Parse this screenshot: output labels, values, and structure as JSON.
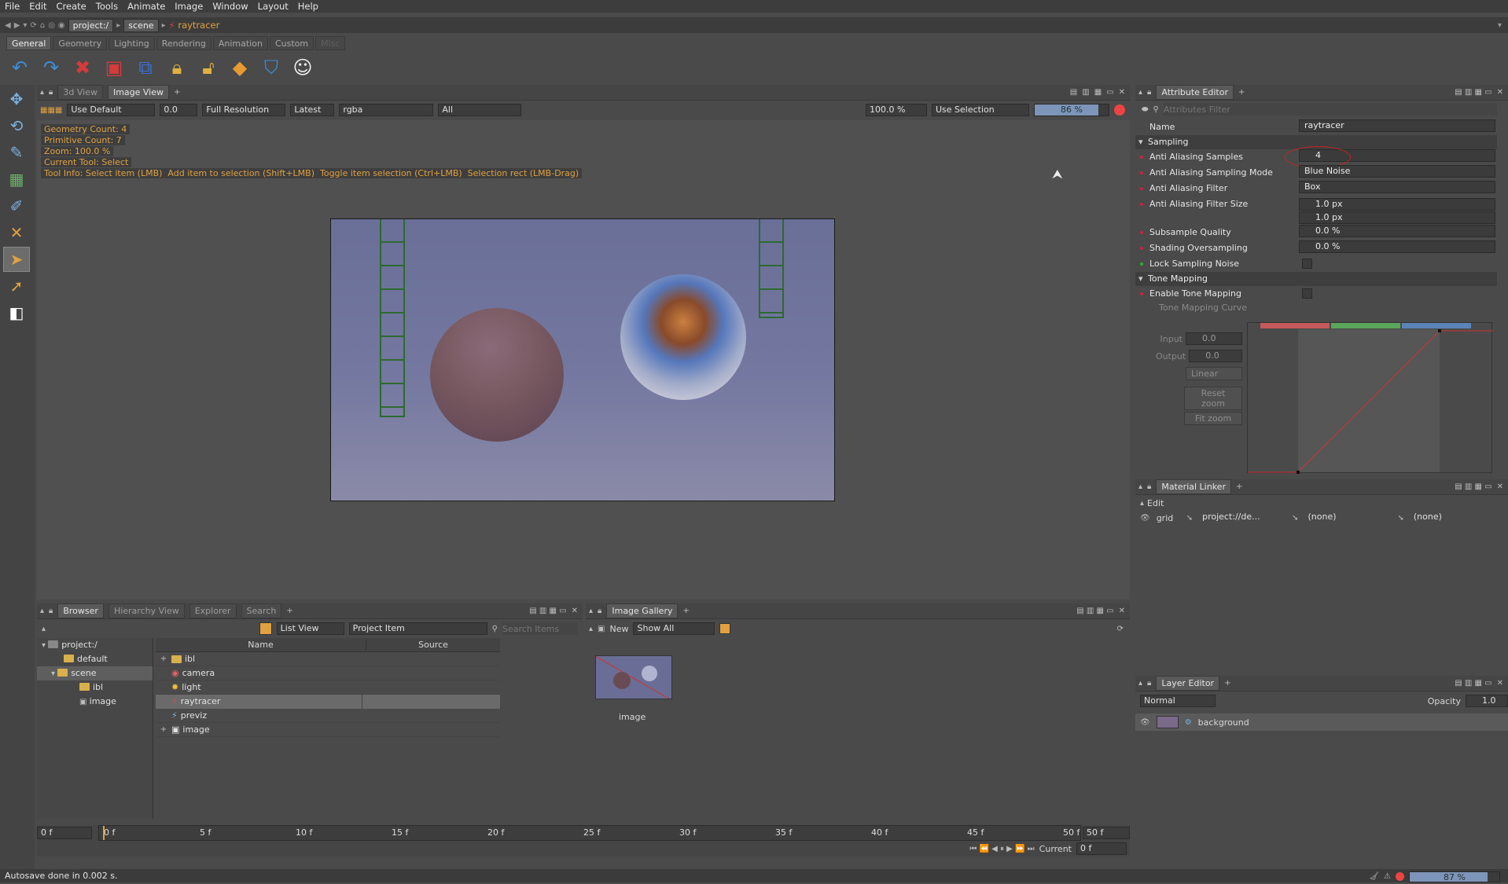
{
  "menu": [
    "File",
    "Edit",
    "Create",
    "Tools",
    "Animate",
    "Image",
    "Window",
    "Layout",
    "Help"
  ],
  "path": {
    "root": "project:/",
    "scene": "scene",
    "current": "raytracer"
  },
  "shelf_tabs": [
    "General",
    "Geometry",
    "Lighting",
    "Rendering",
    "Animation",
    "Custom",
    "Misc"
  ],
  "viewport": {
    "tabs": [
      "3d View",
      "Image View"
    ],
    "toolbar": {
      "layer": "Use Default",
      "exposure": "0.0",
      "resolution": "Full Resolution",
      "version": "Latest",
      "channels": "rgba",
      "filter": "All",
      "zoom": "100.0 %",
      "selection": "Use Selection",
      "progress": "86 %"
    },
    "progress_fraction": 0.86,
    "overlay": {
      "geometry_count": "Geometry Count: 4",
      "primitive_count": "Primitive Count: 7",
      "zoom": "Zoom: 100.0 %",
      "current_tool": "Current Tool: Select",
      "tool_info": "Tool Info: Select item (LMB)  Add item to selection (Shift+LMB)  Toggle item selection (Ctrl+LMB)  Selection rect (LMB-Drag)"
    }
  },
  "attribute_editor": {
    "title": "Attribute Editor",
    "filter_placeholder": "Attributes Filter",
    "name_label": "Name",
    "name_value": "raytracer",
    "sampling_section": "Sampling",
    "rows": [
      {
        "label": "Anti Aliasing Samples",
        "value": "4"
      },
      {
        "label": "Anti Aliasing Sampling Mode",
        "value": "Blue Noise"
      },
      {
        "label": "Anti Aliasing Filter",
        "value": "Box"
      },
      {
        "label": "Anti Aliasing Filter Size",
        "value": "1.0 px",
        "value2": "1.0 px"
      },
      {
        "label": "Subsample Quality",
        "value": "0.0 %"
      },
      {
        "label": "Shading Oversampling",
        "value": "0.0 %"
      },
      {
        "label": "Lock Sampling Noise",
        "value": ""
      }
    ],
    "tone_section": "Tone Mapping",
    "enable_tone": "Enable Tone Mapping",
    "tone_curve": "Tone Mapping Curve",
    "input_label": "Input",
    "input_value": "0.0",
    "output_label": "Output",
    "output_value": "0.0",
    "interp": "Linear",
    "reset_zoom": "Reset zoom",
    "fit_zoom": "Fit zoom"
  },
  "material_linker": {
    "title": "Material Linker",
    "edit": "Edit",
    "item": "grid",
    "material": "project://de...",
    "none1": "(none)",
    "none2": "(none)"
  },
  "layer_editor": {
    "title": "Layer Editor",
    "blend": "Normal",
    "opacity_label": "Opacity",
    "opacity_value": "1.0",
    "layer": "background"
  },
  "browser": {
    "tabs": [
      "Browser",
      "Hierarchy View",
      "Explorer",
      "Search"
    ],
    "view_mode": "List View",
    "item_type": "Project Item",
    "search_placeholder": "Search Items",
    "tree": [
      "project:/",
      "default",
      "scene",
      "ibl",
      "image"
    ],
    "columns": [
      "Name",
      "Source"
    ],
    "items": [
      "ibl",
      "camera",
      "light",
      "raytracer",
      "previz",
      "image"
    ]
  },
  "gallery": {
    "title": "Image Gallery",
    "new": "New",
    "show": "Show All",
    "thumb_label": "image"
  },
  "timeline": {
    "start": "0 f",
    "end": "50 f",
    "ticks": [
      "0 f",
      "5 f",
      "10 f",
      "15 f",
      "20 f",
      "25 f",
      "30 f",
      "35 f",
      "40 f",
      "45 f",
      "50 f"
    ],
    "current_label": "Current",
    "current_value": "0 f"
  },
  "status": {
    "message": "Autosave done in 0.002 s.",
    "memory": "87 %"
  },
  "memory_fraction": 0.87
}
